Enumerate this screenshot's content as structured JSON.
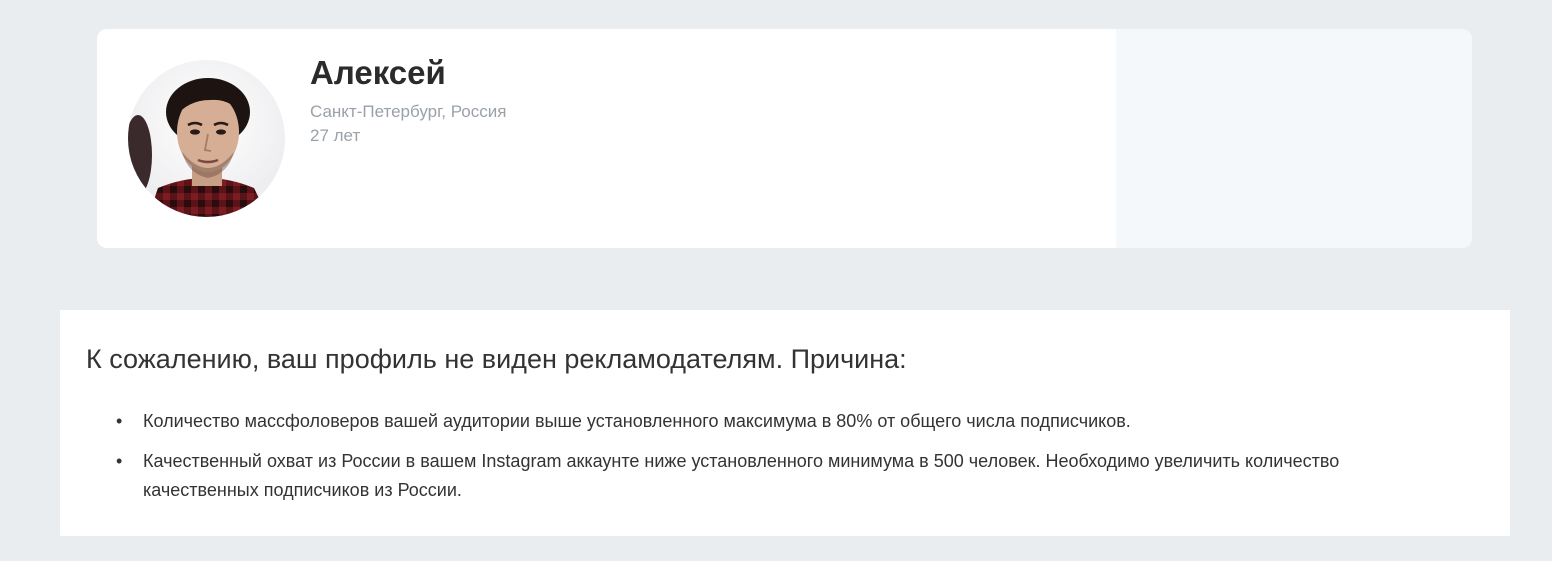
{
  "profile": {
    "name": "Алексей",
    "location": "Санкт-Петербург, Россия",
    "age": "27 лет",
    "avatar_icon": "person-photo"
  },
  "warning": {
    "title": "К сожалению, ваш профиль не виден рекламодателям. Причина:",
    "reasons": [
      "Количество массфоловеров вашей аудитории выше установленного максимума в 80% от общего числа подписчиков.",
      "Качественный охват из России в вашем Instagram аккаунте ниже установленного минимума в 500 человек. Необходимо увеличить количество качественных подписчиков из России."
    ]
  },
  "colors": {
    "page_background": "#eaedf0",
    "card_background": "#ffffff",
    "card_side_background": "#f5f8fb",
    "name_text": "#2b2b2b",
    "muted_text": "#9aa1a9",
    "body_text": "#333333"
  }
}
